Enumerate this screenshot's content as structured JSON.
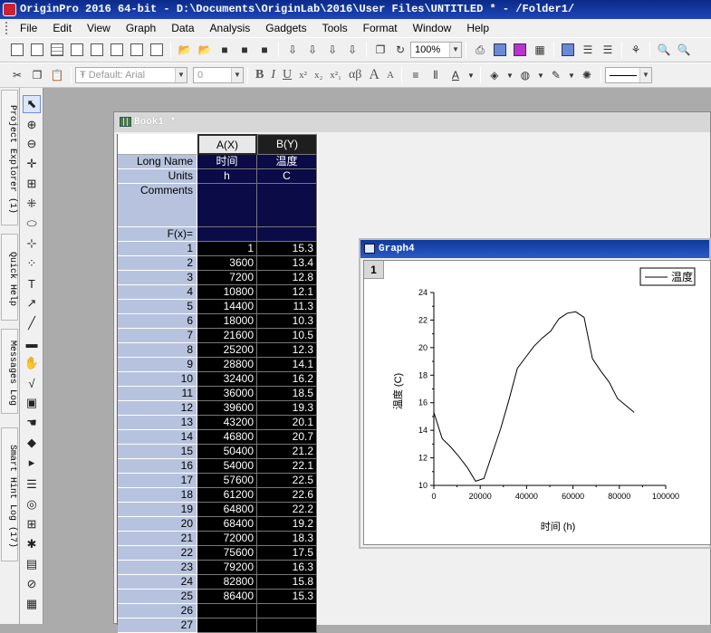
{
  "window": {
    "title": "OriginPro 2016 64-bit - D:\\Documents\\OriginLab\\2016\\User Files\\UNTITLED * - /Folder1/"
  },
  "menu": [
    "File",
    "Edit",
    "View",
    "Graph",
    "Data",
    "Analysis",
    "Gadgets",
    "Tools",
    "Format",
    "Window",
    "Help"
  ],
  "toolbar": {
    "zoom": "100%",
    "font_name": "Default: Arial",
    "font_size": "0",
    "bold": "B",
    "italic": "I",
    "underline": "U",
    "superscript": "x²",
    "subscript": "x₂",
    "supsub": "x²₁",
    "greek": "αβ",
    "grow_font": "A",
    "shrink_font": "A"
  },
  "side_panels": [
    "Project Explorer (1)",
    "Quick Help",
    "Messages Log",
    "Smart Hint Log (17)"
  ],
  "book": {
    "title": "Book1 *",
    "columns": [
      {
        "header": "A(X)",
        "long_name": "时间",
        "units": "h",
        "comments": ""
      },
      {
        "header": "B(Y)",
        "long_name": "温度",
        "units": "C",
        "comments": ""
      }
    ],
    "row_labels": {
      "long_name": "Long Name",
      "units": "Units",
      "comments": "Comments",
      "fx": "F(x)="
    },
    "rows": [
      {
        "n": "1",
        "a": "1",
        "b": "15.3"
      },
      {
        "n": "2",
        "a": "3600",
        "b": "13.4"
      },
      {
        "n": "3",
        "a": "7200",
        "b": "12.8"
      },
      {
        "n": "4",
        "a": "10800",
        "b": "12.1"
      },
      {
        "n": "5",
        "a": "14400",
        "b": "11.3"
      },
      {
        "n": "6",
        "a": "18000",
        "b": "10.3"
      },
      {
        "n": "7",
        "a": "21600",
        "b": "10.5"
      },
      {
        "n": "8",
        "a": "25200",
        "b": "12.3"
      },
      {
        "n": "9",
        "a": "28800",
        "b": "14.1"
      },
      {
        "n": "10",
        "a": "32400",
        "b": "16.2"
      },
      {
        "n": "11",
        "a": "36000",
        "b": "18.5"
      },
      {
        "n": "12",
        "a": "39600",
        "b": "19.3"
      },
      {
        "n": "13",
        "a": "43200",
        "b": "20.1"
      },
      {
        "n": "14",
        "a": "46800",
        "b": "20.7"
      },
      {
        "n": "15",
        "a": "50400",
        "b": "21.2"
      },
      {
        "n": "16",
        "a": "54000",
        "b": "22.1"
      },
      {
        "n": "17",
        "a": "57600",
        "b": "22.5"
      },
      {
        "n": "18",
        "a": "61200",
        "b": "22.6"
      },
      {
        "n": "19",
        "a": "64800",
        "b": "22.2"
      },
      {
        "n": "20",
        "a": "68400",
        "b": "19.2"
      },
      {
        "n": "21",
        "a": "72000",
        "b": "18.3"
      },
      {
        "n": "22",
        "a": "75600",
        "b": "17.5"
      },
      {
        "n": "23",
        "a": "79200",
        "b": "16.3"
      },
      {
        "n": "24",
        "a": "82800",
        "b": "15.8"
      },
      {
        "n": "25",
        "a": "86400",
        "b": "15.3"
      },
      {
        "n": "26",
        "a": "",
        "b": ""
      },
      {
        "n": "27",
        "a": "",
        "b": ""
      }
    ]
  },
  "graph": {
    "title": "Graph4",
    "layer": "1"
  },
  "chart_data": {
    "type": "line",
    "x": [
      1,
      3600,
      7200,
      10800,
      14400,
      18000,
      21600,
      25200,
      28800,
      32400,
      36000,
      39600,
      43200,
      46800,
      50400,
      54000,
      57600,
      61200,
      64800,
      68400,
      72000,
      75600,
      79200,
      82800,
      86400
    ],
    "series": [
      {
        "name": "温度",
        "values": [
          15.3,
          13.4,
          12.8,
          12.1,
          11.3,
          10.3,
          10.5,
          12.3,
          14.1,
          16.2,
          18.5,
          19.3,
          20.1,
          20.7,
          21.2,
          22.1,
          22.5,
          22.6,
          22.2,
          19.2,
          18.3,
          17.5,
          16.3,
          15.8,
          15.3
        ]
      }
    ],
    "xlabel": "时间 (h)",
    "ylabel": "温度 (C)",
    "xlim": [
      0,
      100000
    ],
    "ylim": [
      10,
      24
    ],
    "xticks": [
      "0",
      "20000",
      "40000",
      "60000",
      "80000",
      "100000"
    ],
    "yticks": [
      "10",
      "12",
      "14",
      "16",
      "18",
      "20",
      "22",
      "24"
    ],
    "legend": "top-right",
    "grid": false
  }
}
